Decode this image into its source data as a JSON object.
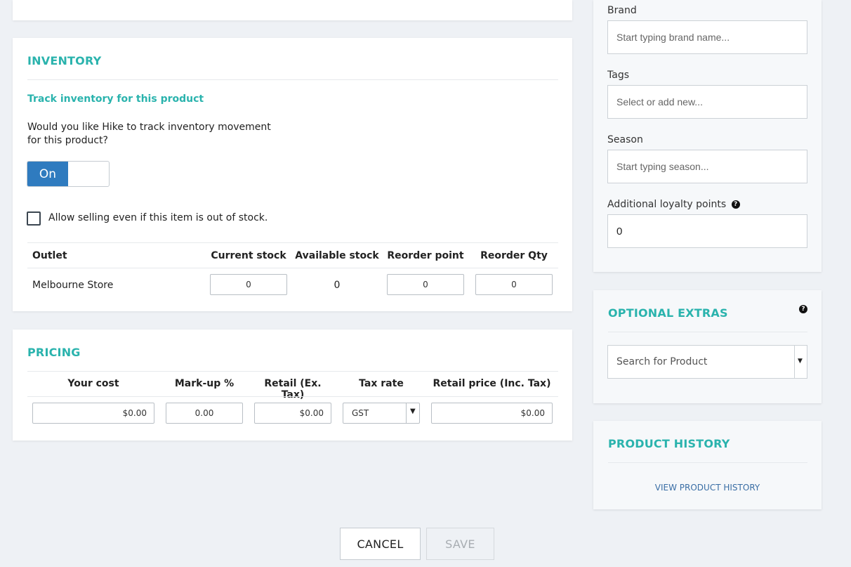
{
  "inventory": {
    "title": "INVENTORY",
    "track_heading": "Track inventory for this product",
    "track_question": "Would you like Hike to track inventory movement for this product?",
    "toggle_on_label": "On",
    "allow_oos_label": "Allow selling even if this item is out of stock.",
    "table": {
      "headers": [
        "Outlet",
        "Current stock",
        "Available stock",
        "Reorder point",
        "Reorder Qty"
      ],
      "rows": [
        {
          "outlet": "Melbourne Store",
          "current_stock": "0",
          "available_stock": "0",
          "reorder_point": "0",
          "reorder_qty": "0"
        }
      ]
    }
  },
  "pricing": {
    "title": "PRICING",
    "headers": [
      "Your cost",
      "Mark-up %",
      "Retail (Ex. Tax)",
      "Tax rate",
      "Retail price (Inc. Tax)"
    ],
    "values": {
      "your_cost": "$0.00",
      "markup": "0.00",
      "retail_ex": "$0.00",
      "tax_rate": "GST",
      "retail_inc": "$0.00"
    }
  },
  "sidebar": {
    "brand_label": "Brand",
    "brand_placeholder": "Start typing brand name...",
    "tags_label": "Tags",
    "tags_placeholder": "Select or add new...",
    "season_label": "Season",
    "season_placeholder": "Start typing season...",
    "loyalty_label": "Additional loyalty points",
    "loyalty_value": "0"
  },
  "optional_extras": {
    "title": "OPTIONAL EXTRAS",
    "search_placeholder": "Search for Product"
  },
  "product_history": {
    "title": "PRODUCT HISTORY",
    "link_label": "VIEW PRODUCT HISTORY"
  },
  "actions": {
    "cancel_label": "CANCEL",
    "save_label": "SAVE"
  },
  "colors": {
    "accent": "#2ab3ad",
    "toggle": "#2f7bbf",
    "link": "#3a6ea5"
  },
  "icons": {
    "help": "question-circle-icon",
    "dropdown": "caret-down-icon"
  }
}
